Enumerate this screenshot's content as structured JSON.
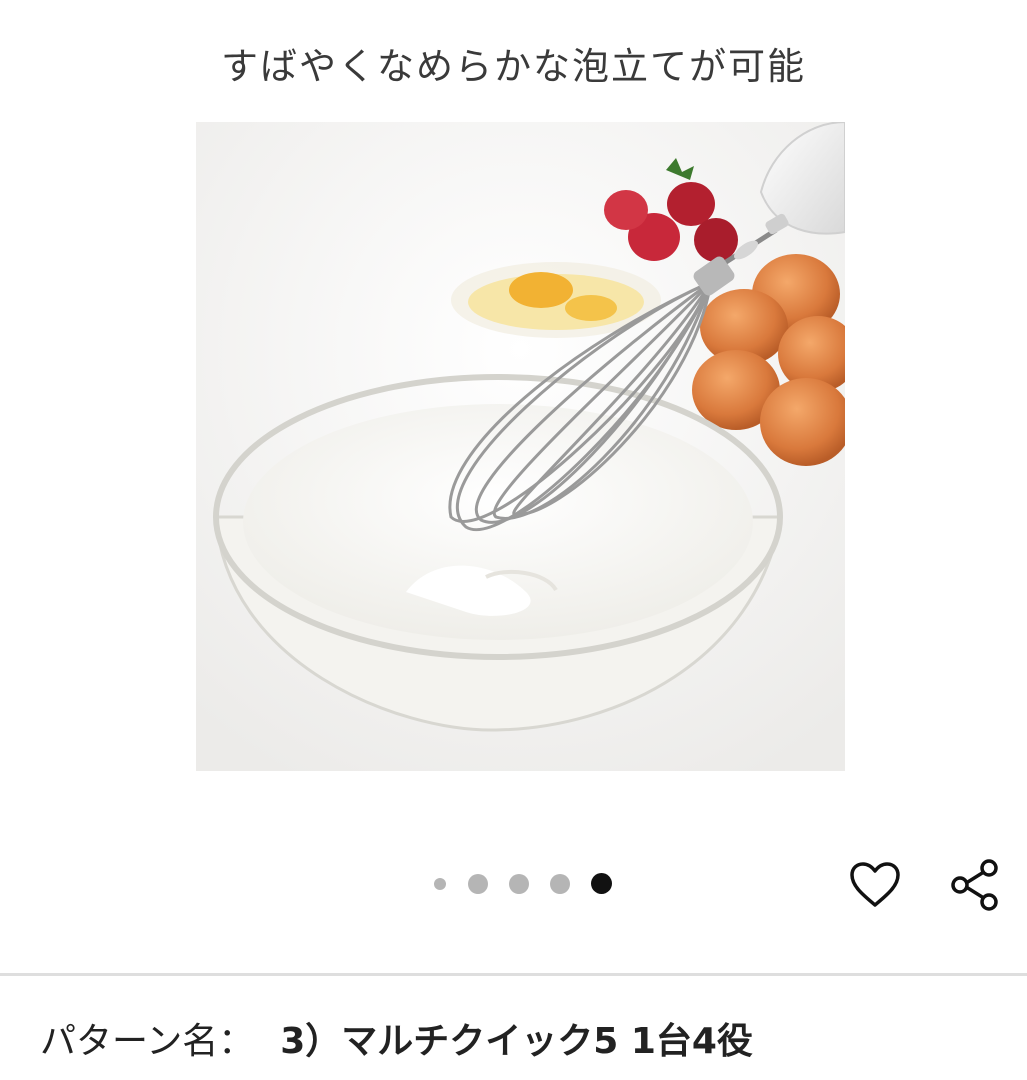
{
  "caption": "すばやくなめらかな泡立てが可能",
  "carousel": {
    "total": 5,
    "active_index": 4
  },
  "actions": {
    "like_icon": "heart-outline-icon",
    "share_icon": "share-icon"
  },
  "product": {
    "pattern_label": "パターン名：",
    "pattern_value": "3）マルチクイック5 1台4役"
  },
  "colors": {
    "active_dot": "#111111",
    "inactive_dot": "#b5b5b5",
    "divider": "#dedede"
  }
}
